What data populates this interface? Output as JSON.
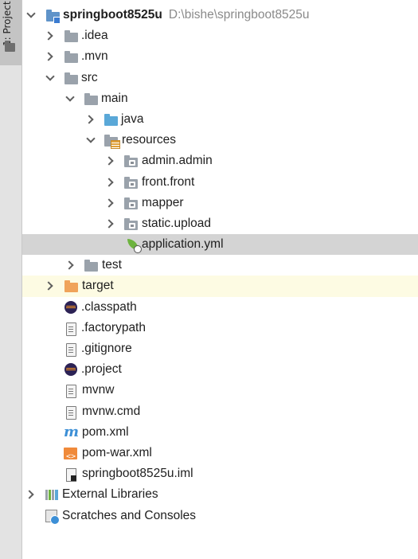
{
  "side_tab": {
    "label": "1: Project"
  },
  "tree": [
    {
      "label": "springboot8525u",
      "path": "D:\\bishe\\springboot8525u"
    },
    {
      "label": ".idea"
    },
    {
      "label": ".mvn"
    },
    {
      "label": "src"
    },
    {
      "label": "main"
    },
    {
      "label": "java"
    },
    {
      "label": "resources"
    },
    {
      "label": "admin.admin"
    },
    {
      "label": "front.front"
    },
    {
      "label": "mapper"
    },
    {
      "label": "static.upload"
    },
    {
      "label": "application.yml"
    },
    {
      "label": "test"
    },
    {
      "label": "target"
    },
    {
      "label": ".classpath"
    },
    {
      "label": ".factorypath"
    },
    {
      "label": ".gitignore"
    },
    {
      "label": ".project"
    },
    {
      "label": "mvnw"
    },
    {
      "label": "mvnw.cmd"
    },
    {
      "label": "pom.xml",
      "icon_glyph": "m"
    },
    {
      "label": "pom-war.xml"
    },
    {
      "label": "springboot8525u.iml"
    },
    {
      "label": "External Libraries"
    },
    {
      "label": "Scratches and Consoles"
    }
  ],
  "colors": {
    "selected_row": "#d4d4d4",
    "highlight_row": "#fdfbe3",
    "folder_grey": "#9aa2ab",
    "folder_blue": "#5aa8d8",
    "folder_orange": "#f0a35a"
  }
}
